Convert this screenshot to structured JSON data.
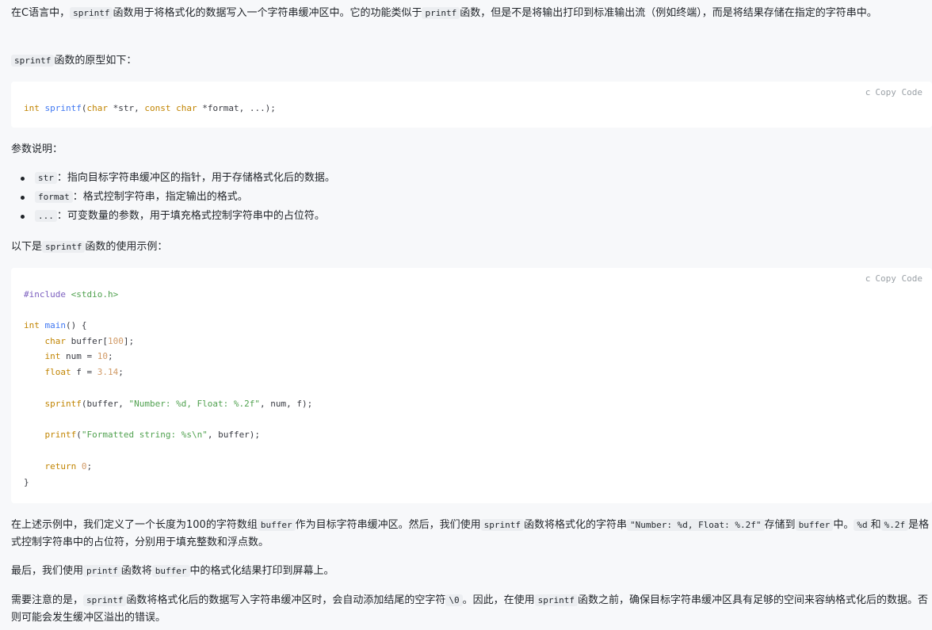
{
  "intro": {
    "t1": "在C语言中，",
    "c1": "sprintf",
    "t2": "函数用于将格式化的数据写入一个字符串缓冲区中。它的功能类似于",
    "c2": "printf",
    "t3": "函数，但是不是将输出打印到标准输出流（例如终端），而是将结果存储在指定的字符串中。"
  },
  "proto_intro": {
    "c1": "sprintf",
    "t1": "函数的原型如下："
  },
  "code1": {
    "lang": "c",
    "copy_label": "Copy Code",
    "line": {
      "a": "int",
      "b": " ",
      "c": "sprintf",
      "d": "(",
      "e": "char",
      "f": " *str, ",
      "g": "const",
      "h": " ",
      "i": "char",
      "j": " *format, ...);"
    }
  },
  "params_title": "参数说明：",
  "params": [
    {
      "code": "str",
      "text": "：指向目标字符串缓冲区的指针，用于存储格式化后的数据。"
    },
    {
      "code": "format",
      "text": "：格式控制字符串，指定输出的格式。"
    },
    {
      "code": "...",
      "text": "：可变数量的参数，用于填充格式控制字符串中的占位符。"
    }
  ],
  "example_intro": {
    "t1": "以下是",
    "c1": "sprintf",
    "t2": "函数的使用示例："
  },
  "code2": {
    "lang": "c",
    "copy_label": "Copy Code",
    "l1": {
      "a": "#include",
      "b": " ",
      "c": "<stdio.h>"
    },
    "l2": {
      "a": "int",
      "b": " ",
      "c": "main",
      "d": "() {"
    },
    "l3": {
      "a": "    ",
      "b": "char",
      "c": " buffer[",
      "d": "100",
      "e": "];"
    },
    "l4": {
      "a": "    ",
      "b": "int",
      "c": " num = ",
      "d": "10",
      "e": ";"
    },
    "l5": {
      "a": "    ",
      "b": "float",
      "c": " f = ",
      "d": "3.14",
      "e": ";"
    },
    "l6": {
      "a": "    ",
      "b": "sprintf",
      "c": "(buffer, ",
      "d": "\"Number: %d, Float: %.2f\"",
      "e": ", num, f);"
    },
    "l7": {
      "a": "    ",
      "b": "printf",
      "c": "(",
      "d": "\"Formatted string: %s\\n\"",
      "e": ", buffer);"
    },
    "l8": {
      "a": "    ",
      "b": "return",
      "c": " ",
      "d": "0",
      "e": ";"
    },
    "l9": "}"
  },
  "explain1": {
    "t1": "在上述示例中，我们定义了一个长度为100的字符数组",
    "c1": "buffer",
    "t2": "作为目标字符串缓冲区。然后，我们使用",
    "c2": "sprintf",
    "t3": "函数将格式化的字符串",
    "c3": "\"Number: %d, Float: %.2f\"",
    "t4": "存储到",
    "c4": "buffer",
    "t5": "中。",
    "c5": "%d",
    "t6": "和",
    "c6": "%.2f",
    "t7": "是格式控制字符串中的占位符，分别用于填充整数和浮点数。"
  },
  "explain2": {
    "t1": "最后，我们使用",
    "c1": "printf",
    "t2": "函数将",
    "c2": "buffer",
    "t3": "中的格式化结果打印到屏幕上。"
  },
  "explain3": {
    "t1": "需要注意的是，",
    "c1": "sprintf",
    "t2": "函数将格式化后的数据写入字符串缓冲区时，会自动添加结尾的空字符",
    "c2": "\\0",
    "t3": "。因此，在使用",
    "c3": "sprintf",
    "t4": "函数之前，确保目标字符串缓冲区具有足够的空间来容纳格式化后的数据。否则可能会发生缓冲区溢出的错误。"
  }
}
